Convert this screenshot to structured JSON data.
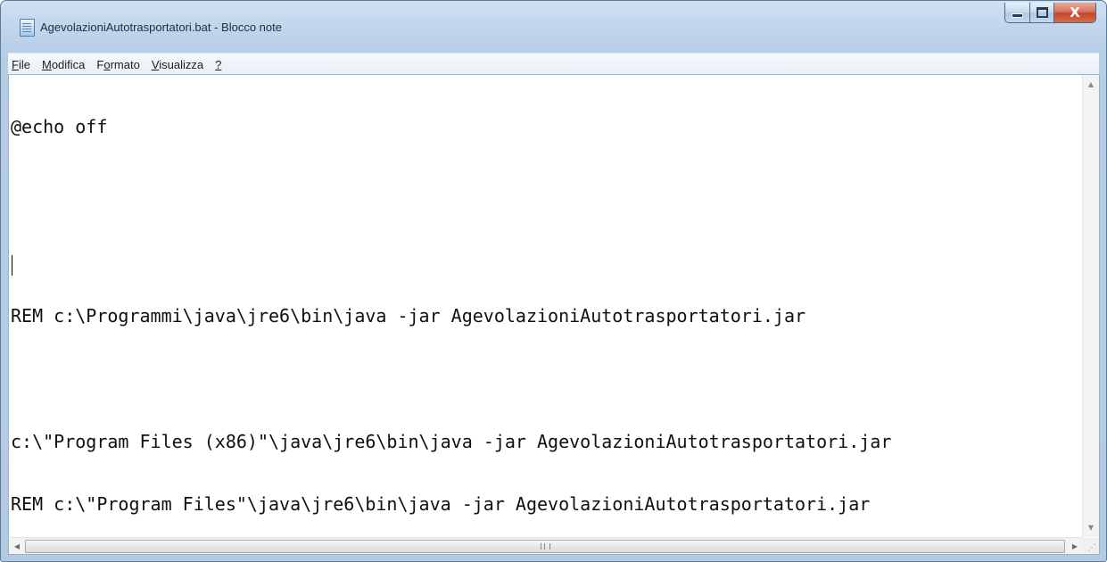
{
  "window": {
    "title": "AgevolazioniAutotrasportatori.bat - Blocco note",
    "controls": {
      "minimize": "–",
      "maximize": "□",
      "close": "X"
    }
  },
  "menu": {
    "items": [
      {
        "accel": "F",
        "rest": "ile"
      },
      {
        "accel": "M",
        "rest": "odifica"
      },
      {
        "pre": "F",
        "accel": "o",
        "rest": "rmato"
      },
      {
        "accel": "V",
        "rest": "isualizza"
      },
      {
        "accel": "?",
        "rest": ""
      }
    ]
  },
  "editor": {
    "lines": [
      "@echo off",
      "",
      "",
      "REM c:\\Programmi\\java\\jre6\\bin\\java -jar AgevolazioniAutotrasportatori.jar",
      "",
      "c:\\\"Program Files (x86)\"\\java\\jre6\\bin\\java -jar AgevolazioniAutotrasportatori.jar",
      "REM c:\\\"Program Files\"\\java\\jre6\\bin\\java -jar AgevolazioniAutotrasportatori.jar"
    ]
  },
  "scrollbars": {
    "up_arrow": "▲",
    "down_arrow": "▼",
    "left_arrow": "◀",
    "right_arrow": "▶"
  },
  "colors": {
    "frame": "#b9cfe7",
    "close_button": "#c9503a"
  }
}
